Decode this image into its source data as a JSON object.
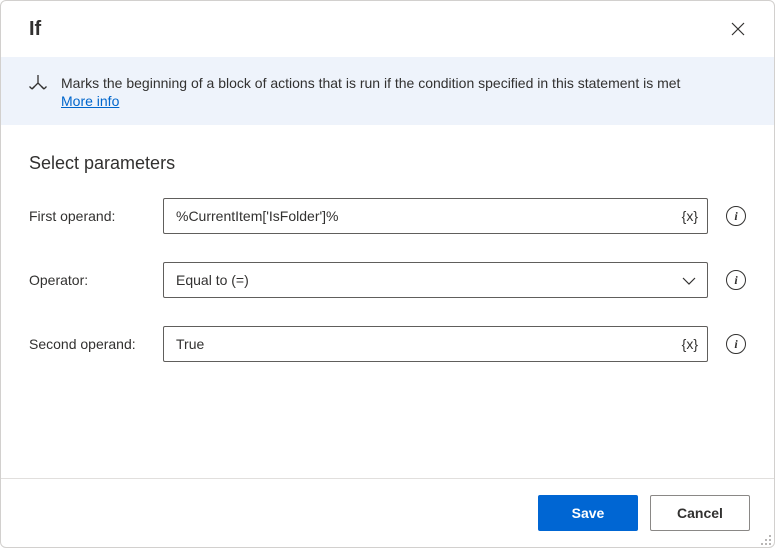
{
  "header": {
    "title": "If"
  },
  "description": {
    "text": "Marks the beginning of a block of actions that is run if the condition specified in this statement is met",
    "more_info_label": "More info"
  },
  "section_title": "Select parameters",
  "params": {
    "first_operand": {
      "label": "First operand:",
      "value": "%CurrentItem['IsFolder']%",
      "variable_token": "{x}"
    },
    "operator": {
      "label": "Operator:",
      "value": "Equal to (=)"
    },
    "second_operand": {
      "label": "Second operand:",
      "value": "True",
      "variable_token": "{x}"
    }
  },
  "footer": {
    "save_label": "Save",
    "cancel_label": "Cancel"
  }
}
